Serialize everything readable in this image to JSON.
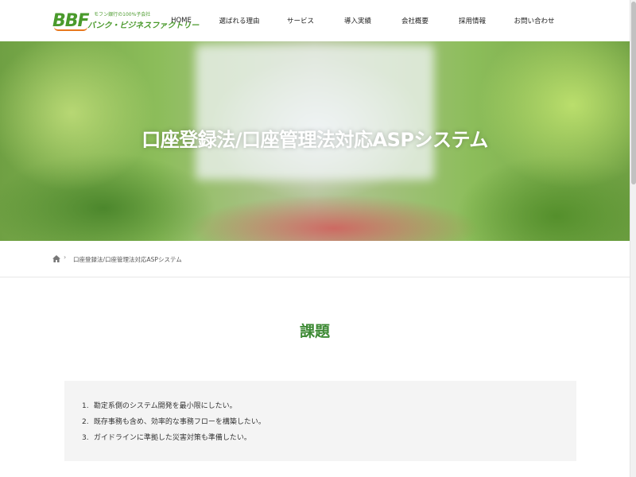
{
  "header": {
    "logo_mark": "BBF",
    "logo_sub": "モフン銀行の100%子会社",
    "logo_name": "バンク・ビジネスファクトリー",
    "nav": [
      {
        "label": "HOME",
        "name": "nav-home"
      },
      {
        "label": "選ばれる理由",
        "name": "nav-reasons"
      },
      {
        "label": "サービス",
        "name": "nav-services"
      },
      {
        "label": "導入実績",
        "name": "nav-track-record"
      },
      {
        "label": "会社概要",
        "name": "nav-company"
      },
      {
        "label": "採用情報",
        "name": "nav-recruit"
      },
      {
        "label": "お問い合わせ",
        "name": "nav-contact"
      }
    ]
  },
  "hero": {
    "title": "口座登録法/口座管理法対応ASPシステム"
  },
  "breadcrumb": {
    "current": "口座登録法/口座管理法対応ASPシステム"
  },
  "main": {
    "section_title": "課題",
    "issues": [
      {
        "num": "1.",
        "text": "勘定系側のシステム開発を最小限にしたい。"
      },
      {
        "num": "2.",
        "text": "既存事務も含め、効率的な事務フローを構築したい。"
      },
      {
        "num": "3.",
        "text": "ガイドラインに準拠した災害対策も準備したい。"
      }
    ]
  },
  "colors": {
    "accent_green": "#3e8a35",
    "logo_green": "#4a9a2c",
    "logo_orange": "#e8781e",
    "box_bg": "#f4f4f4"
  }
}
